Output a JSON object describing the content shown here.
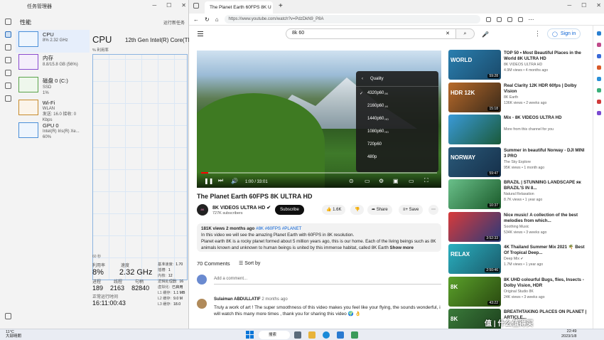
{
  "taskmgr": {
    "title": "任务管理器",
    "header_tab": "性能",
    "run_task": "运行新任务",
    "items": [
      {
        "name": "CPU",
        "sub1": "8% 2.32 GHz",
        "sub2": ""
      },
      {
        "name": "内存",
        "sub1": "8.8/15.8 GB (56%)",
        "sub2": ""
      },
      {
        "name": "磁盘 0 (C:)",
        "sub1": "SSD",
        "sub2": "1%"
      },
      {
        "name": "Wi-Fi",
        "sub1": "WLAN",
        "sub2": "发送: 16.0 接收: 0 Kbps"
      },
      {
        "name": "GPU 0",
        "sub1": "Intel(R) Iris(R) Xe...",
        "sub2": "60%"
      }
    ],
    "main_title": "CPU",
    "cpu_model": "12th Gen Intel(R) Core(TM)",
    "util_label": "% 利用率",
    "seconds": "60 秒",
    "util_lbl": "利用率",
    "speed_lbl": "速度",
    "util_val": "8%",
    "speed_val": "2.32 GHz",
    "proc_lbl": "进程",
    "thread_lbl": "线程",
    "handle_lbl": "句柄",
    "proc_val": "189",
    "thread_val": "2163",
    "handle_val": "82840",
    "uptime_lbl": "正常运行时间",
    "uptime_val": "16:11:00:43",
    "side_lbls": [
      "基准速度:",
      "插槽:",
      "内核:",
      "逻辑处理器:",
      "虚拟化:",
      "L1 缓存:",
      "L2 缓存:",
      "L3 缓存:"
    ],
    "side_vals": [
      "1.70",
      "1",
      "12",
      "16",
      "已启用",
      "1.1 MB",
      "9.0 M",
      "18.0"
    ]
  },
  "browser": {
    "tab_title": "The Planet Earth 60FPS 8K U",
    "url": "https://www.youtube.com/watch?v=PdzDkN9_P8A"
  },
  "youtube": {
    "search_value": "8k 60",
    "search_clear": "✕",
    "search_icon": "⌕",
    "mic_icon": "🎤",
    "more_icon": "⋮",
    "signin": "Sign in",
    "player": {
      "time": "1:00 / 33:01",
      "progress": 0.03,
      "quality_header": "Quality",
      "quality_options": [
        {
          "label": "4320p60",
          "sup": "8K",
          "selected": true
        },
        {
          "label": "2160p60",
          "sup": "4K",
          "selected": false
        },
        {
          "label": "1440p60",
          "sup": "HD",
          "selected": false
        },
        {
          "label": "1080p60",
          "sup": "HD",
          "selected": false
        },
        {
          "label": "720p60",
          "sup": "",
          "selected": false
        },
        {
          "label": "480p",
          "sup": "",
          "selected": false
        }
      ]
    },
    "video_title": "The Planet Earth 60FPS 8K ULTRA HD",
    "channel": {
      "name": "8K VIDEOS ULTRA HD",
      "verified": "✔",
      "subs": "727K subscribers",
      "avatar": "8K"
    },
    "subscribe": "Subscribe",
    "likes": "1.6K",
    "share": "Share",
    "save": "Save",
    "description": {
      "meta": "181K views  2 months ago",
      "tags": "#8K #60FPS #PLANET",
      "line1": "In this video we will see the amazing Planet Earth with 60FPS in 8K resolution.",
      "line2": "Planet earth 8K is a rocky planet formed about 5 million years ago, this is our home. Each of the living beings such as 8K animals known and unknown to human beings is united by this immense habitat, called 8K Earth",
      "more": "Show more"
    },
    "comments_count": "70 Comments",
    "sort_by": "Sort by",
    "add_comment": "Add a comment...",
    "comment": {
      "author": "Sulaiman ABDULLATIF",
      "ago": "2 months ago",
      "text": "Truly a work of art ! The super smoothness of this video makes you feel like your flying, the sounds wonderful, i will watch this many more times , thank you for sharing this video 🌍 👌"
    },
    "recommendations": [
      {
        "title": "TOP 50 • Most Beautiful Places in the World 8K ULTRA HD",
        "channel": "8K VIDEOS ULTRA HD",
        "meta": "4.9M views • 4 months ago",
        "dur": "59:28",
        "cap": "WORLD",
        "c1": "#2a7fb0",
        "c2": "#1a4a6a"
      },
      {
        "title": "Real Clarity 12K HDR 60fps | Dolby Vision",
        "channel": "8K Earth",
        "meta": "136K views • 2 weeks ago",
        "dur": "15:18",
        "cap": "HDR 12K",
        "c1": "#b86a2a",
        "c2": "#3a2a1a"
      },
      {
        "title": "Mix - 8K VIDEOS ULTRA HD",
        "channel": "More from this channel for you",
        "meta": "",
        "dur": "",
        "cap": "",
        "c1": "#3a9ad8",
        "c2": "#1a5a3a"
      },
      {
        "title": "Summer in beautiful Norway - DJI MINI 3 PRO",
        "channel": "The Sky Explore",
        "meta": "95K views • 1 month ago",
        "dur": "59:47",
        "cap": "NORWAY",
        "c1": "#2a5a7a",
        "c2": "#16304a"
      },
      {
        "title": "BRAZIL | STUNNING LANDSCAPE як BRAZIL'S IN 8...",
        "channel": "Natural Relaxation",
        "meta": "8.7K views • 1 year ago",
        "dur": "10:37",
        "cap": "",
        "c1": "#6ac08a",
        "c2": "#1a5a2a"
      },
      {
        "title": "Nice music! A collection of the best melodies from which...",
        "channel": "Soothing Music",
        "meta": "534K views • 3 weeks ago",
        "dur": "3:52:33",
        "cap": "",
        "c1": "#d83a3a",
        "c2": "#2a3a7a"
      },
      {
        "title": "4K Thailand Summer Mix 2021 🌴 Best Of Tropical Deep...",
        "channel": "Deep Mix ✔",
        "meta": "1.7M views • 1 year ago",
        "dur": "2:50:46",
        "cap": "RELAX",
        "c1": "#2ab0c0",
        "c2": "#1a5a6a"
      },
      {
        "title": "8K UHD colourful Bugs, flies, Insects - Dolby Vision, HDR",
        "channel": "Original Studio 8K",
        "meta": "24K views • 3 weeks ago",
        "dur": "43:22",
        "cap": "8K",
        "c1": "#5aa02a",
        "c2": "#2a4a10"
      },
      {
        "title": "BREATHTAKING PLACES ON PLANET | ARTICLE...",
        "channel": "",
        "meta": "",
        "dur": "",
        "cap": "8K",
        "c1": "#3a7a3a",
        "c2": "#1a3a1a"
      }
    ]
  },
  "taskbar": {
    "temp": "11°C",
    "weather": "大部晴朗",
    "search": "搜索",
    "time": "22:49",
    "date": "2023/1/8"
  },
  "watermark": "值 | 什么值得买"
}
